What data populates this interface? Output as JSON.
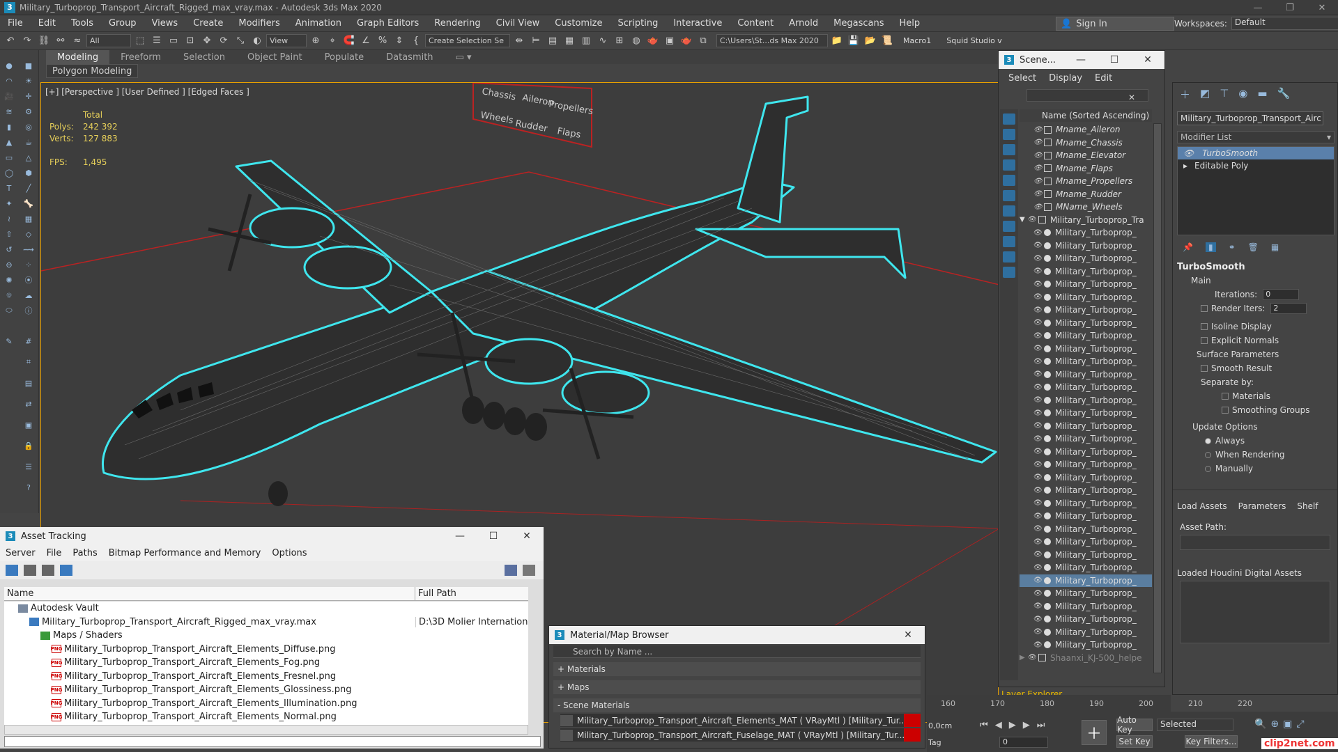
{
  "window": {
    "title": "Military_Turboprop_Transport_Aircraft_Rigged_max_vray.max - Autodesk 3ds Max 2020",
    "app_icon": "3"
  },
  "menu": [
    "File",
    "Edit",
    "Tools",
    "Group",
    "Views",
    "Create",
    "Modifiers",
    "Animation",
    "Graph Editors",
    "Rendering",
    "Civil View",
    "Customize",
    "Scripting",
    "Interactive",
    "Content",
    "Arnold",
    "Megascans",
    "Help"
  ],
  "account": {
    "sign_in": "Sign In",
    "workspaces_label": "Workspaces:",
    "workspace": "Default"
  },
  "toolbar": {
    "filter": "All",
    "ref_coord": "View",
    "selection_set": "Create Selection Se",
    "path": "C:\\Users\\St...ds Max 2020",
    "macro": "Macro1",
    "studio": "Squid Studio v"
  },
  "ribbon": {
    "tabs": [
      "Modeling",
      "Freeform",
      "Selection",
      "Object Paint",
      "Populate",
      "Datasmith"
    ],
    "active": "Modeling",
    "sub": "Polygon Modeling"
  },
  "viewport": {
    "label": "[+] [Perspective ] [User Defined ] [Edged Faces ]",
    "stats": {
      "total_label": "Total",
      "polys_label": "Polys:",
      "polys": "242 392",
      "verts_label": "Verts:",
      "verts": "127 883",
      "fps_label": "FPS:",
      "fps": "1,495"
    },
    "rig_labels": [
      "Chassis",
      "Aileron",
      "Propellers",
      "Wheels",
      "Rudder",
      "Flaps"
    ]
  },
  "scene_explorer": {
    "title": "Scene...",
    "menu": [
      "Select",
      "Display",
      "Edit"
    ],
    "column": "Name (Sorted Ascending)",
    "items": [
      {
        "name": "Mname_Aileron",
        "kind": "helper"
      },
      {
        "name": "Mname_Chassis",
        "kind": "helper"
      },
      {
        "name": "Mname_Elevator",
        "kind": "helper"
      },
      {
        "name": "Mname_Flaps",
        "kind": "helper"
      },
      {
        "name": "Mname_Propellers",
        "kind": "helper"
      },
      {
        "name": "Mname_Rudder",
        "kind": "helper"
      },
      {
        "name": "MName_Wheels",
        "kind": "helper"
      },
      {
        "name": "Military_Turboprop_Tra",
        "kind": "group"
      },
      {
        "name": "Military_Turboprop_",
        "kind": "mesh"
      },
      {
        "name": "Military_Turboprop_",
        "kind": "mesh"
      },
      {
        "name": "Military_Turboprop_",
        "kind": "mesh"
      },
      {
        "name": "Military_Turboprop_",
        "kind": "mesh"
      },
      {
        "name": "Military_Turboprop_",
        "kind": "mesh"
      },
      {
        "name": "Military_Turboprop_",
        "kind": "mesh"
      },
      {
        "name": "Military_Turboprop_",
        "kind": "mesh"
      },
      {
        "name": "Military_Turboprop_",
        "kind": "mesh"
      },
      {
        "name": "Military_Turboprop_",
        "kind": "mesh"
      },
      {
        "name": "Military_Turboprop_",
        "kind": "mesh"
      },
      {
        "name": "Military_Turboprop_",
        "kind": "mesh"
      },
      {
        "name": "Military_Turboprop_",
        "kind": "mesh"
      },
      {
        "name": "Military_Turboprop_",
        "kind": "mesh"
      },
      {
        "name": "Military_Turboprop_",
        "kind": "mesh"
      },
      {
        "name": "Military_Turboprop_",
        "kind": "mesh"
      },
      {
        "name": "Military_Turboprop_",
        "kind": "mesh"
      },
      {
        "name": "Military_Turboprop_",
        "kind": "mesh"
      },
      {
        "name": "Military_Turboprop_",
        "kind": "mesh"
      },
      {
        "name": "Military_Turboprop_",
        "kind": "mesh"
      },
      {
        "name": "Military_Turboprop_",
        "kind": "mesh"
      },
      {
        "name": "Military_Turboprop_",
        "kind": "mesh"
      },
      {
        "name": "Military_Turboprop_",
        "kind": "mesh"
      },
      {
        "name": "Military_Turboprop_",
        "kind": "mesh"
      },
      {
        "name": "Military_Turboprop_",
        "kind": "mesh"
      },
      {
        "name": "Military_Turboprop_",
        "kind": "mesh"
      },
      {
        "name": "Military_Turboprop_",
        "kind": "mesh"
      },
      {
        "name": "Military_Turboprop_",
        "kind": "mesh"
      },
      {
        "name": "Military_Turboprop_",
        "kind": "mesh"
      },
      {
        "name": "Military_Turboprop_",
        "kind": "mesh"
      },
      {
        "name": "Military_Turboprop_",
        "kind": "mesh"
      },
      {
        "name": "Military_Turboprop_",
        "kind": "mesh"
      },
      {
        "name": "Military_Turboprop_",
        "kind": "mesh"
      },
      {
        "name": "Military_Turboprop_",
        "kind": "mesh"
      },
      {
        "name": "Shaanxi_KJ-500_helpe",
        "kind": "hidden"
      }
    ],
    "footer": "Layer Explorer"
  },
  "command_panel": {
    "object_name": "Military_Turboprop_Transport_Airc",
    "modifier_list": "Modifier List",
    "stack": [
      "TurboSmooth",
      "Editable Poly"
    ],
    "turbosmooth": {
      "title": "TurboSmooth",
      "main": "Main",
      "iterations_label": "Iterations:",
      "iterations": "0",
      "render_iters_label": "Render Iters:",
      "render_iters": "2",
      "isoline": "Isoline Display",
      "explicit": "Explicit Normals",
      "surface": "Surface Parameters",
      "smooth_result": "Smooth Result",
      "separate_by": "Separate by:",
      "materials": "Materials",
      "smoothing_groups": "Smoothing Groups",
      "update_options": "Update Options",
      "always": "Always",
      "when_rendering": "When Rendering",
      "manually": "Manually"
    },
    "houdini_tabs": [
      "Load Assets",
      "Parameters",
      "Shelf"
    ],
    "asset_path": "Asset Path:",
    "loaded_houdini": "Loaded Houdini Digital Assets"
  },
  "asset_tracking": {
    "title": "Asset Tracking",
    "menu": [
      "Server",
      "File",
      "Paths",
      "Bitmap Performance and Memory",
      "Options"
    ],
    "columns": [
      "Name",
      "Full Path"
    ],
    "rows": [
      {
        "name": "Autodesk Vault",
        "path": "",
        "indent": 1
      },
      {
        "name": "Military_Turboprop_Transport_Aircraft_Rigged_max_vray.max",
        "path": "D:\\3D Molier International",
        "indent": 2
      },
      {
        "name": "Maps / Shaders",
        "path": "",
        "indent": 3
      },
      {
        "name": "Military_Turboprop_Transport_Aircraft_Elements_Diffuse.png",
        "path": "",
        "indent": 4
      },
      {
        "name": "Military_Turboprop_Transport_Aircraft_Elements_Fog.png",
        "path": "",
        "indent": 4
      },
      {
        "name": "Military_Turboprop_Transport_Aircraft_Elements_Fresnel.png",
        "path": "",
        "indent": 4
      },
      {
        "name": "Military_Turboprop_Transport_Aircraft_Elements_Glossiness.png",
        "path": "",
        "indent": 4
      },
      {
        "name": "Military_Turboprop_Transport_Aircraft_Elements_Illumination.png",
        "path": "",
        "indent": 4
      },
      {
        "name": "Military_Turboprop_Transport_Aircraft_Elements_Normal.png",
        "path": "",
        "indent": 4
      }
    ]
  },
  "material_browser": {
    "title": "Material/Map Browser",
    "search": "Search by Name ...",
    "groups": [
      "+ Materials",
      "+ Maps",
      "- Scene Materials"
    ],
    "materials": [
      "Military_Turboprop_Transport_Aircraft_Elements_MAT ( VRayMtl ) [Military_Tur...",
      "Military_Turboprop_Transport_Aircraft_Fuselage_MAT ( VRayMtl ) [Military_Tur..."
    ]
  },
  "timeline": {
    "ticks": [
      "160",
      "170",
      "180",
      "190",
      "200",
      "210",
      "220"
    ],
    "units": "0,0cm",
    "frame": "0",
    "tag": "Tag"
  },
  "anim": {
    "auto_key": "Auto Key",
    "set_key": "Set Key",
    "selected": "Selected",
    "key_filters": "Key Filters..."
  },
  "watermark": "clip2net.com"
}
